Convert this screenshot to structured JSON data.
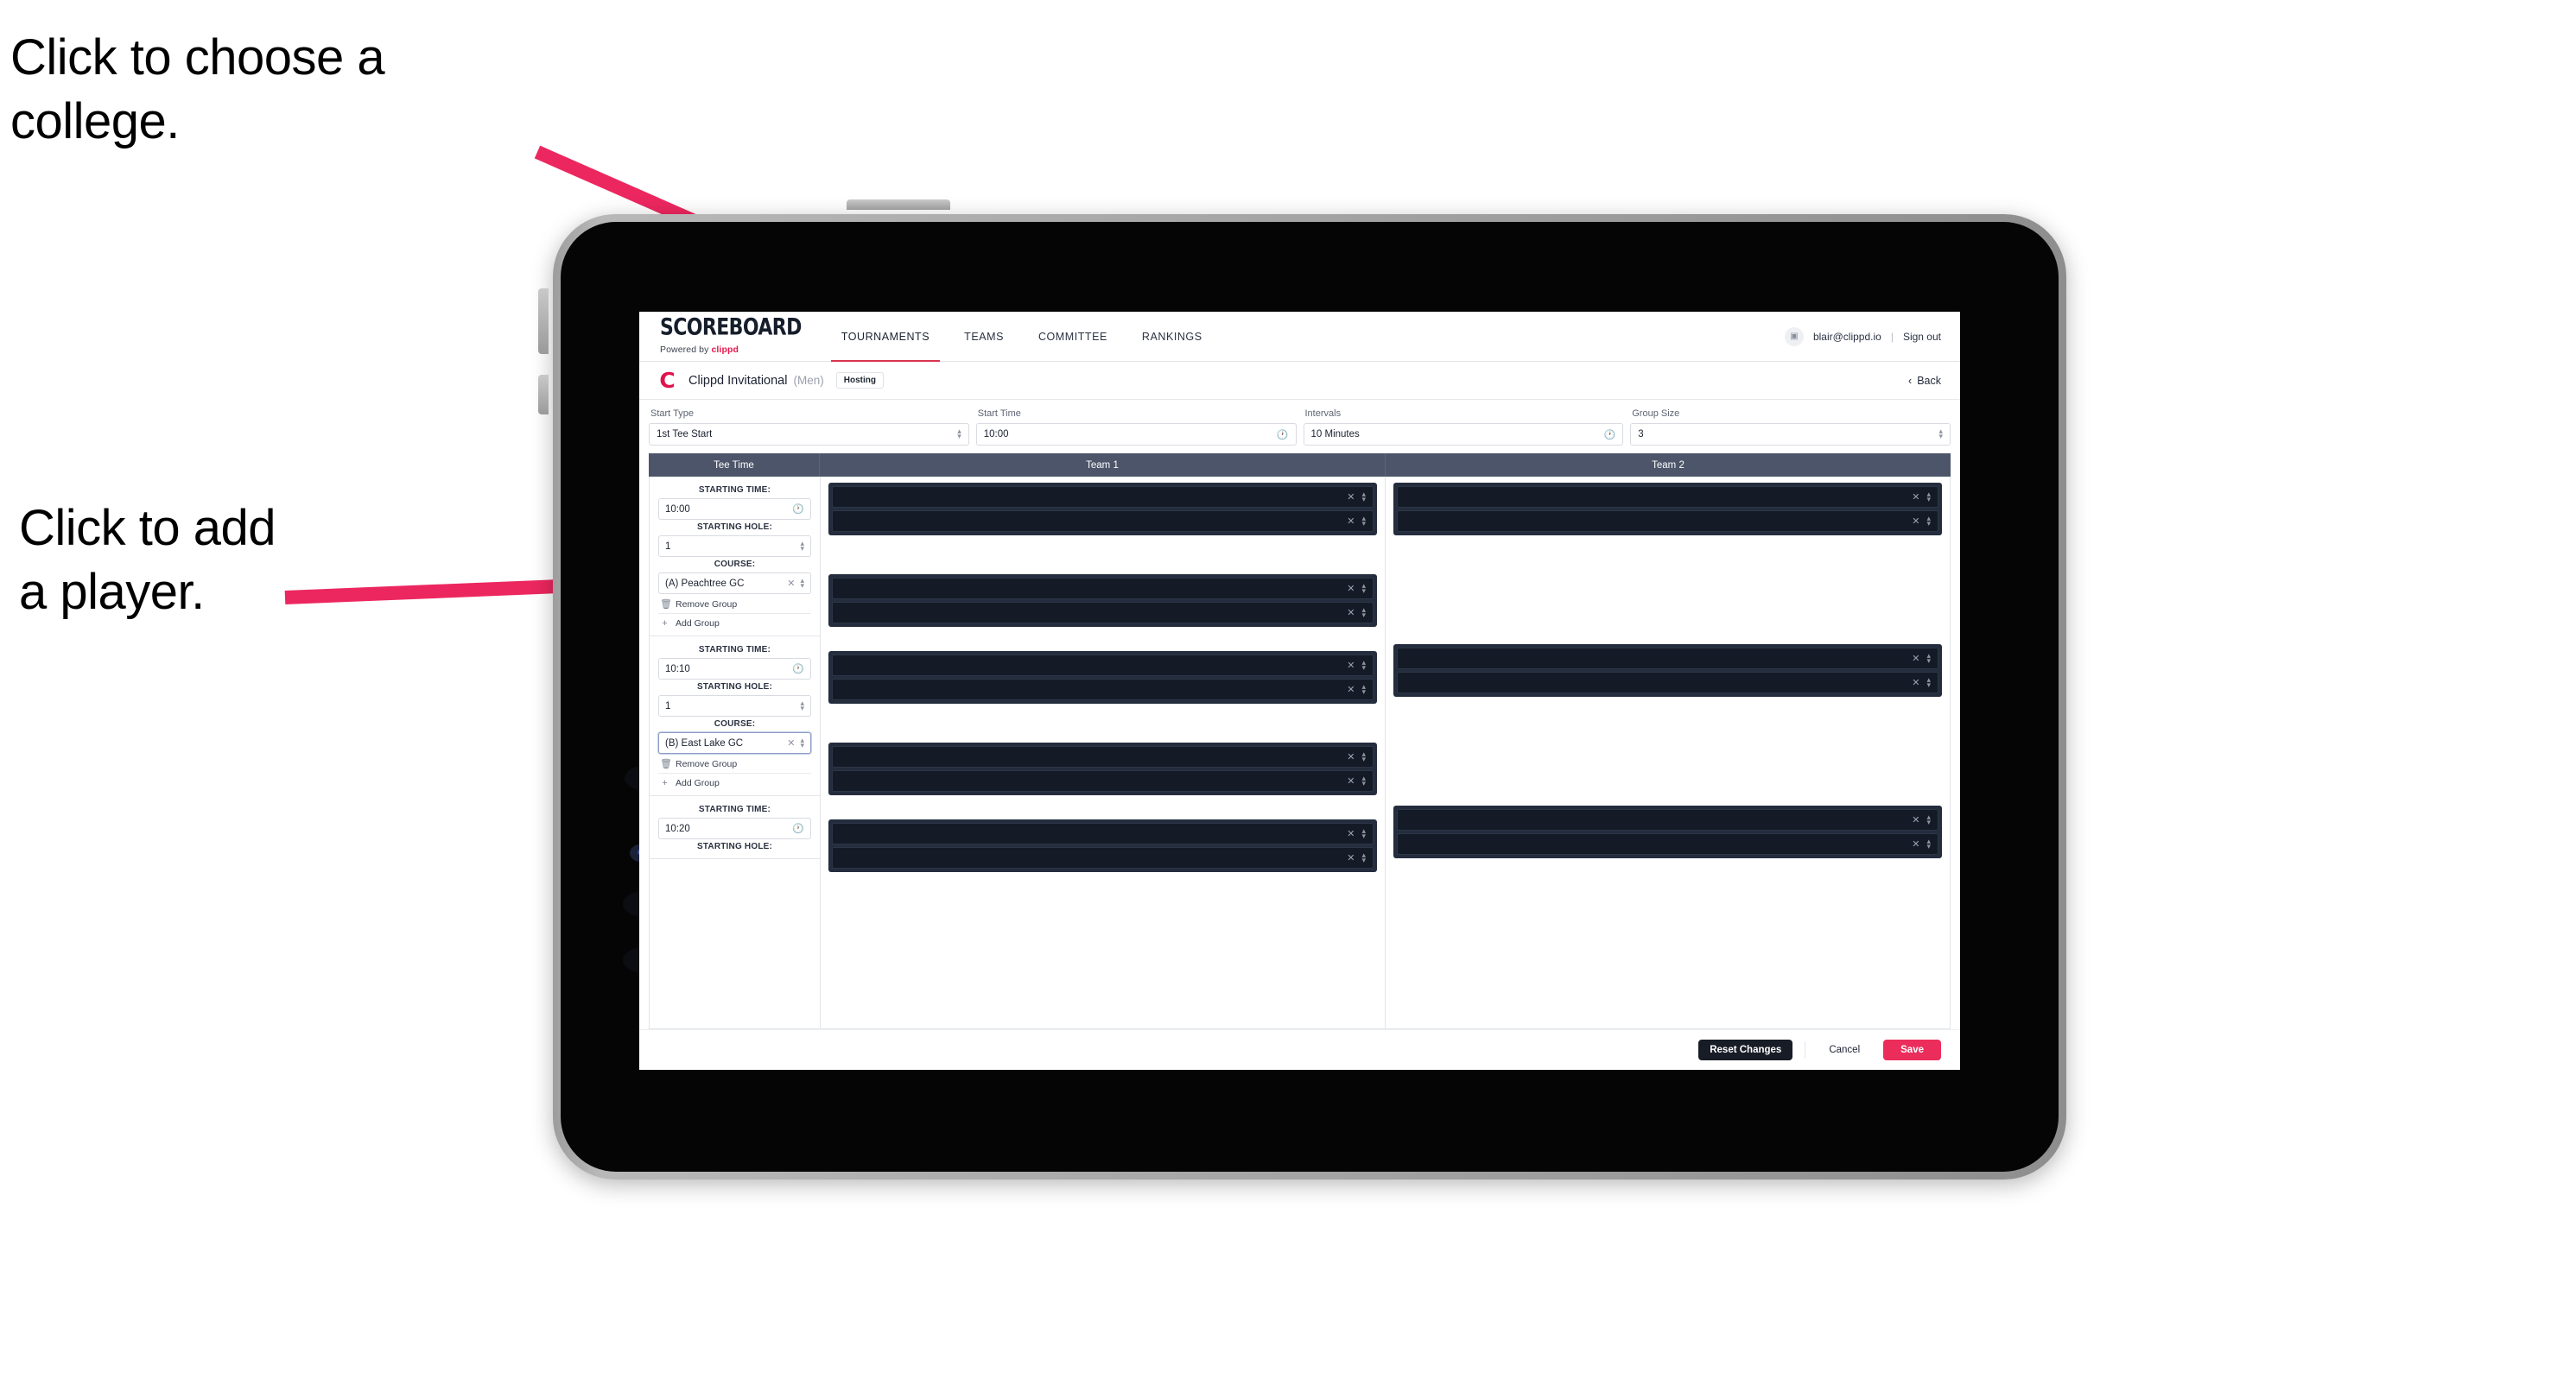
{
  "annotations": [
    {
      "id": "choose-college",
      "text": "Click to choose a\ncollege."
    },
    {
      "id": "add-player",
      "text": "Click to add\na player."
    }
  ],
  "accent": {
    "brand_pink": "#e8174c",
    "save_pink": "#eb2d5b",
    "tab_underline": "#d8324f",
    "table_header": "#4c5569"
  },
  "topnav": {
    "brand": {
      "title": "SCOREBOARD",
      "sub_prefix": "Powered by ",
      "sub_brand": "clippd"
    },
    "tabs": [
      {
        "label": "TOURNAMENTS",
        "active": true
      },
      {
        "label": "TEAMS",
        "active": false
      },
      {
        "label": "COMMITTEE",
        "active": false
      },
      {
        "label": "RANKINGS",
        "active": false
      }
    ],
    "avatar_glyph": "▣",
    "email": "blair@clippd.io",
    "separator": "|",
    "signout": "Sign out"
  },
  "tournament_bar": {
    "mark": "C",
    "name": "Clippd Invitational",
    "gender": "(Men)",
    "badge": "Hosting",
    "back_chevron": "‹",
    "back_label": "Back"
  },
  "settings": [
    {
      "label": "Start Type",
      "value": "1st Tee Start",
      "icon": "stepper-icon"
    },
    {
      "label": "Start Time",
      "value": "10:00",
      "icon": "clock-icon"
    },
    {
      "label": "Intervals",
      "value": "10 Minutes",
      "icon": "clock-icon"
    },
    {
      "label": "Group Size",
      "value": "3",
      "icon": "stepper-icon"
    }
  ],
  "table": {
    "headers": {
      "tee_time": "Tee Time",
      "team1": "Team 1",
      "team2": "Team 2"
    },
    "labels": {
      "starting_time": "STARTING TIME:",
      "starting_hole": "STARTING HOLE:",
      "course": "COURSE:",
      "remove_group": "Remove Group",
      "add_group": "Add Group"
    },
    "groups": [
      {
        "starting_time": "10:00",
        "starting_hole": "1",
        "course": "(A) Peachtree GC",
        "course_focused": false,
        "team1_blocks": [
          2,
          2
        ],
        "team2_blocks": [
          2
        ]
      },
      {
        "starting_time": "10:10",
        "starting_hole": "1",
        "course": "(B) East Lake GC",
        "course_focused": true,
        "team1_blocks": [
          2,
          2
        ],
        "team2_blocks": [
          2
        ]
      },
      {
        "starting_time": "10:20",
        "starting_hole": "",
        "course": "",
        "course_focused": false,
        "team1_blocks": [
          2
        ],
        "team2_blocks": [
          2
        ]
      }
    ]
  },
  "footer": {
    "reset": "Reset Changes",
    "cancel": "Cancel",
    "save": "Save"
  }
}
